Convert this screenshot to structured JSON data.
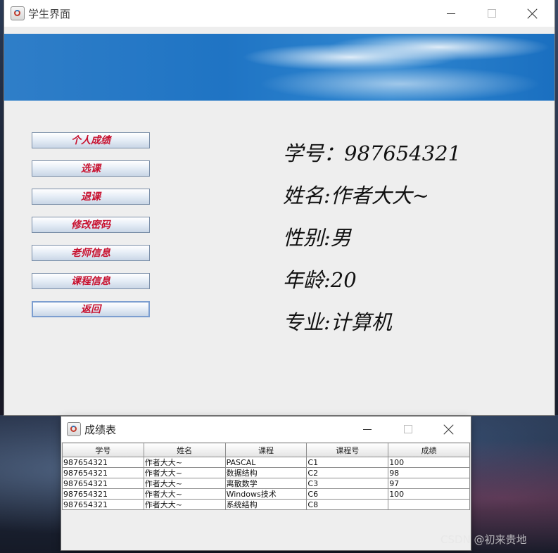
{
  "main_window": {
    "title": "学生界面",
    "menu_buttons": [
      "个人成绩",
      "选课",
      "退课",
      "修改密码",
      "老师信息",
      "课程信息",
      "返回"
    ],
    "info": {
      "student_id": "学号：987654321",
      "name": "姓名:作者大大~",
      "gender": "性别:男",
      "age": "年龄:20",
      "major": "专业:计算机"
    }
  },
  "score_window": {
    "title": "成绩表",
    "columns": [
      "学号",
      "姓名",
      "课程",
      "课程号",
      "成绩"
    ],
    "rows": [
      [
        "987654321",
        "作者大大~",
        "PASCAL",
        "C1",
        "100"
      ],
      [
        "987654321",
        "作者大大~",
        "数据结构",
        "C2",
        "98"
      ],
      [
        "987654321",
        "作者大大~",
        "离散数学",
        "C3",
        "97"
      ],
      [
        "987654321",
        "作者大大~",
        "Windows技术",
        "C6",
        "100"
      ],
      [
        "987654321",
        "作者大大~",
        "系统结构",
        "C8",
        ""
      ]
    ]
  },
  "watermark": "CSDN @初来贵地"
}
